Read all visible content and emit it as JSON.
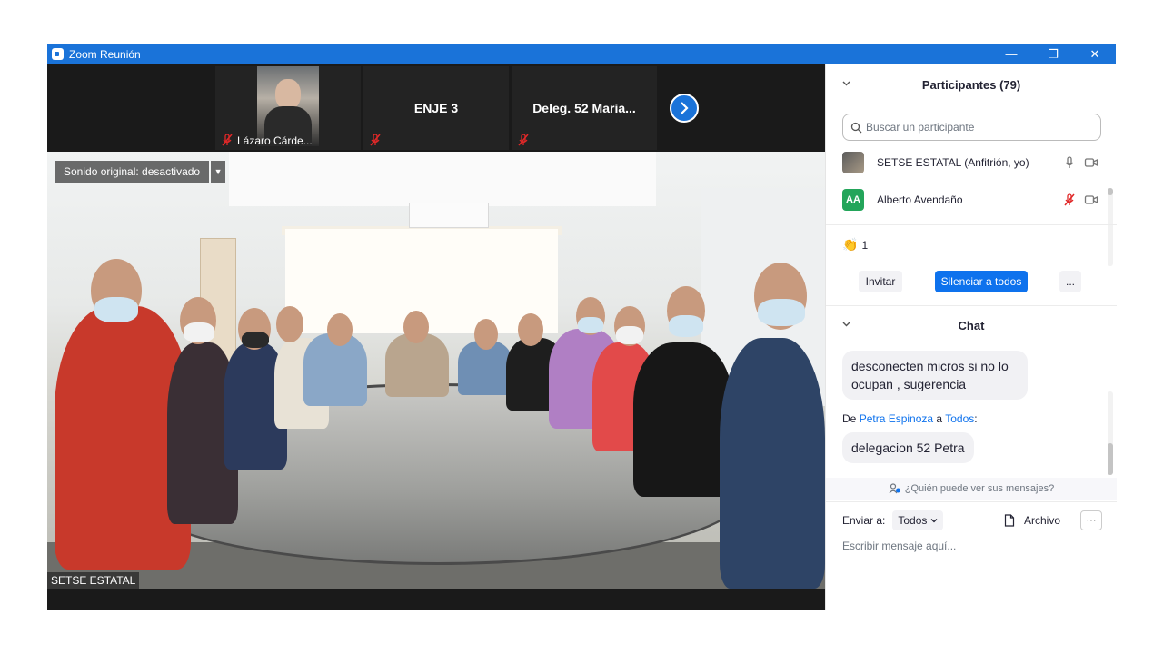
{
  "window": {
    "title": "Zoom Reunión",
    "min": "—",
    "restore": "❐",
    "close": "✕"
  },
  "thumbnails": [
    {
      "label": "Lázaro Cárde..."
    },
    {
      "name": "ENJE 3"
    },
    {
      "name": "Deleg. 52  Maria..."
    }
  ],
  "main_video": {
    "sound_label": "Sonido original: desactivado",
    "speaker": "SETSE ESTATAL"
  },
  "participants": {
    "header": "Participantes (79)",
    "search_placeholder": "Buscar un participante",
    "list": [
      {
        "name": "SETSE ESTATAL (Anfitrión, yo)",
        "initials": ""
      },
      {
        "name": "Alberto Avendaño",
        "initials": "AA"
      }
    ],
    "reaction_count": "1",
    "invite": "Invitar",
    "mute_all": "Silenciar a todos",
    "more": "..."
  },
  "chat": {
    "header": "Chat",
    "messages": [
      {
        "text": "desconecten micros si no lo ocupan , sugerencia"
      },
      {
        "from_prefix": "De",
        "from_name": "Petra Espinoza",
        "to_word": "a",
        "to_name": "Todos",
        "suffix": ":",
        "text": "delegacion 52 Petra"
      }
    ],
    "who_sees": "¿Quién puede ver sus mensajes?",
    "send_to": "Enviar a:",
    "recipient": "Todos",
    "file": "Archivo",
    "more": "···",
    "input_placeholder": "Escribir mensaje aquí..."
  },
  "colors": {
    "titlebar": "#1a73d9",
    "accent": "#0e72ed",
    "mute_red": "#e02828",
    "avatar_green": "#23a55a"
  }
}
